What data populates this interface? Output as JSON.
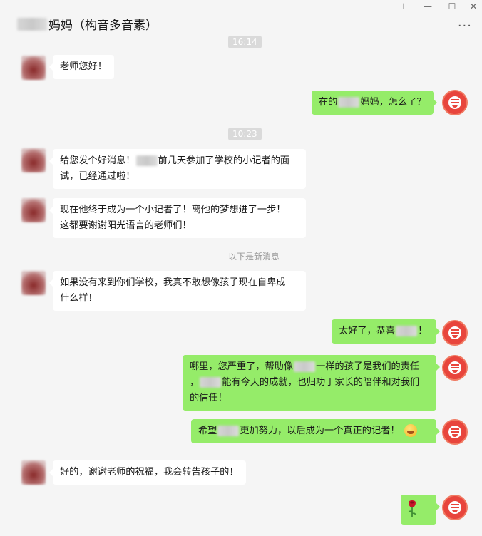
{
  "window": {
    "title_suffix": "妈妈（构音多音素）",
    "pin_icon": "⊥",
    "minimize_icon": "—",
    "maximize_icon": "☐",
    "close_icon": "✕",
    "more_icon": "···"
  },
  "chat": {
    "top_timestamp": "16:14",
    "mid_timestamp": "10:23",
    "divider_text": "以下是新消息",
    "messages": [
      {
        "from": "contact",
        "text": "老师您好！"
      },
      {
        "from": "teacher",
        "parts": [
          "在的",
          "妈妈，怎么了？"
        ]
      },
      {
        "from": "contact",
        "parts": [
          "给您发个好消息！",
          "前几天参加了学校的小记者的面",
          "试，已经通过啦！"
        ]
      },
      {
        "from": "contact",
        "lines": [
          "现在他终于成为一个小记者了！离他的梦想进了一步！",
          "这都要谢谢阳光语言的老师们！"
        ]
      },
      {
        "from": "contact",
        "lines": [
          "如果没有来到你们学校，我真不敢想像孩子现在自卑成",
          "什么样！"
        ]
      },
      {
        "from": "teacher",
        "parts": [
          "太好了，恭喜",
          "！"
        ]
      },
      {
        "from": "teacher",
        "parts": [
          "哪里，您严重了，帮助像",
          "一样的孩子是我们的责任",
          "，",
          "能有今天的成就，也归功于家长的陪伴和对我们",
          "的信任！"
        ]
      },
      {
        "from": "teacher",
        "parts": [
          "希望",
          "更加努力，以后成为一个真正的记者！"
        ]
      },
      {
        "from": "contact",
        "text": "好的，谢谢老师的祝福，我会转告孩子的！"
      },
      {
        "from": "teacher",
        "sticker": "rose"
      }
    ]
  },
  "colors": {
    "self_bubble": "#95ec69",
    "other_bubble": "#ffffff",
    "background": "#f5f5f5",
    "avatar_brand": "#e8453c"
  }
}
